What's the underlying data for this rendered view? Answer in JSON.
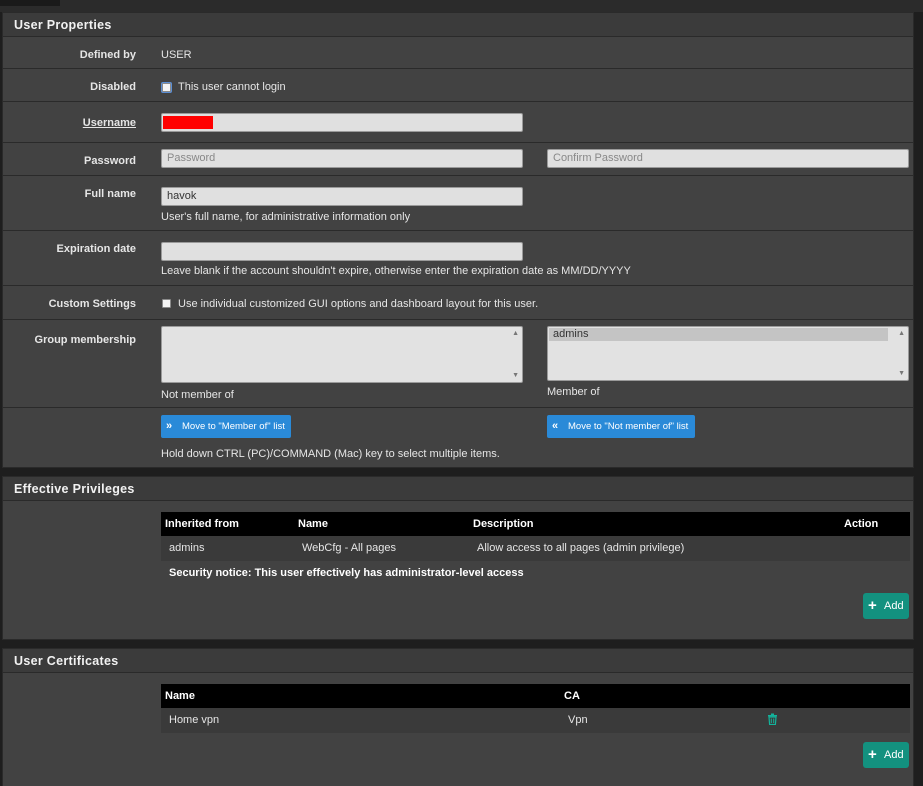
{
  "user_properties": {
    "title": "User Properties",
    "defined_by": {
      "label": "Defined by",
      "value": "USER"
    },
    "disabled": {
      "label": "Disabled",
      "checkbox_text": "This user cannot login",
      "checked": false
    },
    "username": {
      "label": "Username",
      "value": ""
    },
    "password": {
      "label": "Password",
      "placeholder": "Password",
      "confirm_placeholder": "Confirm Password"
    },
    "full_name": {
      "label": "Full name",
      "value": "havok",
      "help": "User's full name, for administrative information only"
    },
    "expiration": {
      "label": "Expiration date",
      "value": "",
      "help": "Leave blank if the account shouldn't expire, otherwise enter the expiration date as MM/DD/YYYY"
    },
    "custom_settings": {
      "label": "Custom Settings",
      "checkbox_text": "Use individual customized GUI options and dashboard layout for this user.",
      "checked": false
    },
    "group_membership": {
      "label": "Group membership",
      "not_member_label": "Not member of",
      "member_label": "Member of",
      "not_member_items": [],
      "member_items": [
        "admins"
      ],
      "move_to_member_button": "Move to \"Member of\" list",
      "move_to_not_member_button": "Move to \"Not member of\" list",
      "help": "Hold down CTRL (PC)/COMMAND (Mac) key to select multiple items."
    }
  },
  "effective_privileges": {
    "title": "Effective Privileges",
    "columns": [
      "Inherited from",
      "Name",
      "Description",
      "Action"
    ],
    "rows": [
      {
        "inherited_from": "admins",
        "name": "WebCfg - All pages",
        "description": "Allow access to all pages (admin privilege)"
      }
    ],
    "notice": "Security notice: This user effectively has administrator-level access",
    "add_button": "Add"
  },
  "user_certificates": {
    "title": "User Certificates",
    "columns": [
      "Name",
      "CA"
    ],
    "rows": [
      {
        "name": "Home vpn",
        "ca": "Vpn"
      }
    ],
    "add_button": "Add"
  },
  "colors": {
    "panel_bg": "#424242",
    "button_blue": "#2a8ad8",
    "button_green": "#13917f",
    "redaction": "#ff0000"
  }
}
